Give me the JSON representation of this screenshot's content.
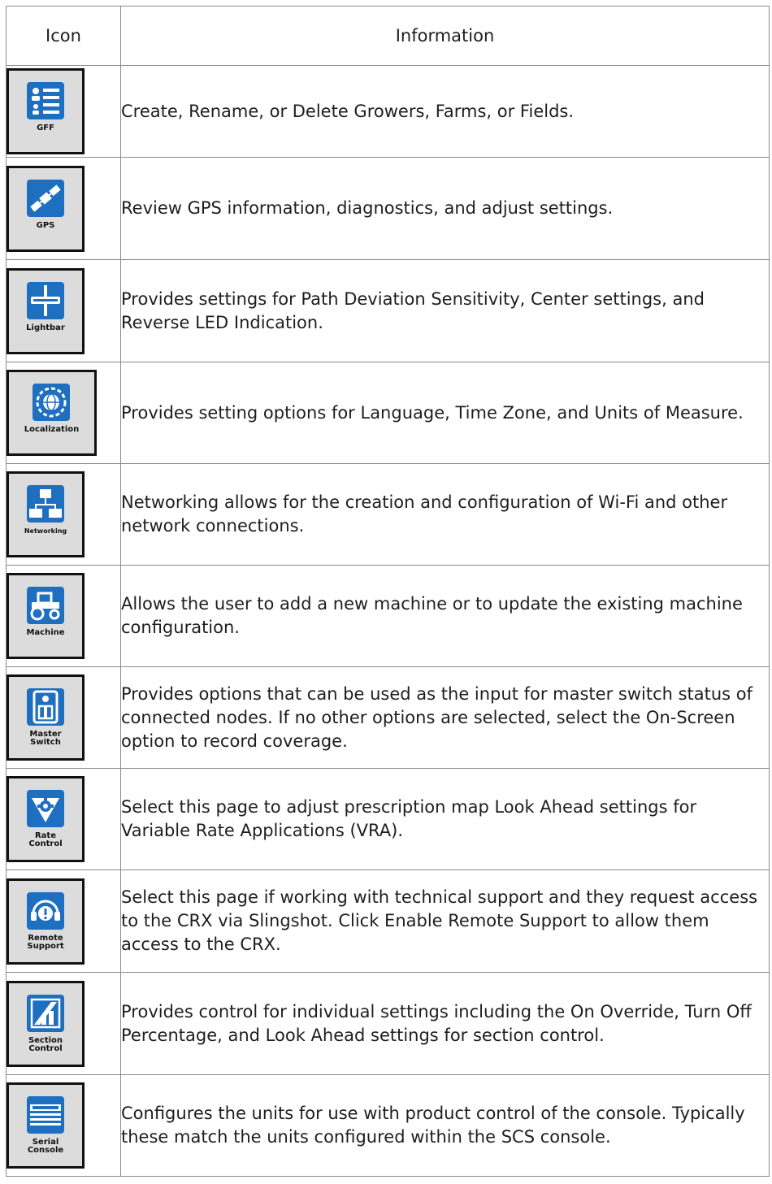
{
  "table": {
    "headers": {
      "icon": "Icon",
      "information": "Information"
    },
    "rows": [
      {
        "icon_label": "GFF",
        "icon": "gff-icon",
        "text": "Create, Rename, or Delete Growers, Farms, or Fields."
      },
      {
        "icon_label": "GPS",
        "icon": "gps-satellite-icon",
        "text": "Review GPS information, diagnostics, and adjust settings."
      },
      {
        "icon_label": "Lightbar",
        "icon": "lightbar-icon",
        "text": "Provides settings for Path Deviation Sensitivity, Center settings, and Reverse LED Indication."
      },
      {
        "icon_label": "Localization",
        "icon": "localization-globe-icon",
        "text": "Provides setting options for Language, Time Zone, and Units of Measure."
      },
      {
        "icon_label": "Networking",
        "icon": "networking-icon",
        "text": "Networking allows for the creation and configuration of Wi-Fi and other network connections."
      },
      {
        "icon_label": "Machine",
        "icon": "machine-tractor-icon",
        "text": "Allows the user to add a new machine or to update the existing machine configuration."
      },
      {
        "icon_label": "Master Switch",
        "icon": "master-switch-icon",
        "text": "Provides options that can be used as the input for master switch status of connected nodes. If no other options are selected, select the On-Screen option to record coverage."
      },
      {
        "icon_label": "Rate Control",
        "icon": "rate-control-icon",
        "text": "Select this page to adjust prescription map Look Ahead settings for Variable Rate Applications (VRA)."
      },
      {
        "icon_label": "Remote Support",
        "icon": "remote-support-icon",
        "text": "Select this page if working with technical support and they request access to the CRX via Slingshot. Click Enable Remote Support to allow them access to the CRX."
      },
      {
        "icon_label": "Section Control",
        "icon": "section-control-icon",
        "text": "Provides control for individual settings including the On Override, Turn Off Percentage, and Look Ahead settings for section control."
      },
      {
        "icon_label": "Serial Console",
        "icon": "serial-console-icon",
        "text": "Configures the units for use with product control of the console. Typically these match the units configured within the SCS console."
      }
    ]
  }
}
